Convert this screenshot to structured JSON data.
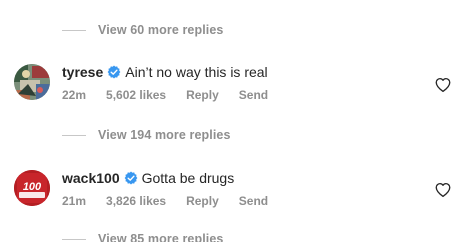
{
  "thread": {
    "view_more_1": "View 60 more replies",
    "view_more_2": "View 194 more replies",
    "view_more_3": "View 85 more replies",
    "comments": [
      {
        "username": "tyrese",
        "text": "Ain’t no way this is real",
        "time": "22m",
        "likes": "5,602 likes",
        "reply_label": "Reply",
        "send_label": "Send"
      },
      {
        "username": "wack100",
        "text": "Gotta be drugs",
        "time": "21m",
        "likes": "3,826 likes",
        "reply_label": "Reply",
        "send_label": "Send",
        "avatar_text": "100"
      }
    ]
  },
  "colors": {
    "verified": "#3897f0",
    "muted": "#8e8e8e",
    "text": "#262626",
    "wack_avatar": "#b41e23"
  }
}
